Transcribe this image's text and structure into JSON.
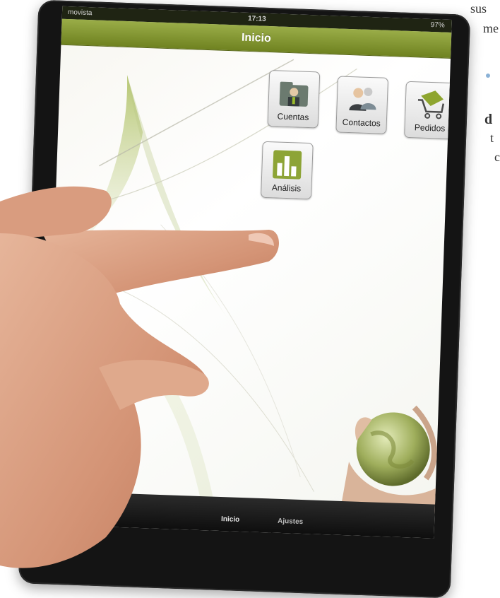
{
  "page_text": {
    "line1": "sus",
    "line2": "me",
    "line3": "d",
    "line4": "t",
    "line5": "c"
  },
  "status_bar": {
    "carrier": "movista",
    "time": "17:13",
    "battery": "97%"
  },
  "nav": {
    "title": "Inicio"
  },
  "apps": [
    {
      "label": "Cuentas",
      "icon": "accounts-folder-icon"
    },
    {
      "label": "Contactos",
      "icon": "contacts-people-icon"
    },
    {
      "label": "Pedidos",
      "icon": "orders-cart-icon"
    },
    {
      "label": "Análisis",
      "icon": "analysis-chart-icon"
    }
  ],
  "tabs": [
    {
      "label": "Inicio",
      "selected": true
    },
    {
      "label": "Ajustes",
      "selected": false
    }
  ],
  "colors": {
    "accent": "#8da436",
    "nav_dark": "#6f8220",
    "bullet": "#8ab1d6"
  }
}
